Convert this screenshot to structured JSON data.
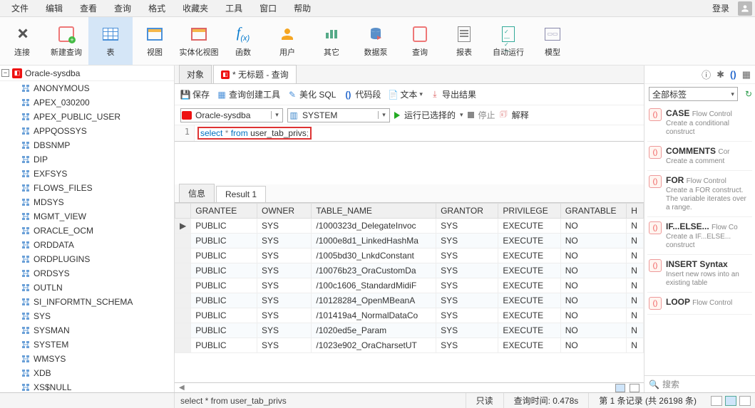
{
  "menu": {
    "items": [
      "文件",
      "编辑",
      "查看",
      "查询",
      "格式",
      "收藏夹",
      "工具",
      "窗口",
      "帮助"
    ],
    "login": "登录"
  },
  "toolbar": [
    {
      "label": "连接",
      "icon": "plug"
    },
    {
      "label": "新建查询",
      "icon": "newq"
    },
    {
      "label": "表",
      "icon": "table",
      "active": true
    },
    {
      "label": "视图",
      "icon": "view"
    },
    {
      "label": "实体化视图",
      "icon": "mview"
    },
    {
      "label": "函数",
      "icon": "fx"
    },
    {
      "label": "用户",
      "icon": "user"
    },
    {
      "label": "其它",
      "icon": "other"
    },
    {
      "label": "数据泵",
      "icon": "pump"
    },
    {
      "label": "查询",
      "icon": "query"
    },
    {
      "label": "报表",
      "icon": "report"
    },
    {
      "label": "自动运行",
      "icon": "auto"
    },
    {
      "label": "模型",
      "icon": "model"
    }
  ],
  "connection_name": "Oracle-sysdba",
  "users": [
    "ANONYMOUS",
    "APEX_030200",
    "APEX_PUBLIC_USER",
    "APPQOSSYS",
    "DBSNMP",
    "DIP",
    "EXFSYS",
    "FLOWS_FILES",
    "MDSYS",
    "MGMT_VIEW",
    "ORACLE_OCM",
    "ORDDATA",
    "ORDPLUGINS",
    "ORDSYS",
    "OUTLN",
    "SI_INFORMTN_SCHEMA",
    "SYS",
    "SYSMAN",
    "SYSTEM",
    "WMSYS",
    "XDB",
    "XS$NULL"
  ],
  "editor_tabs": {
    "t1": "对象",
    "t2": "* 无标题 - 查询"
  },
  "query_tb": {
    "save": "保存",
    "builder": "查询创建工具",
    "beautify": "美化 SQL",
    "snippet": "代码段",
    "text": "文本",
    "export": "导出结果"
  },
  "conn_combo": "Oracle-sysdba",
  "schema_combo": "SYSTEM",
  "run_row": {
    "run": "运行已选择的",
    "stop": "停止",
    "explain": "解释"
  },
  "sql_line_no": "1",
  "sql": {
    "kw1": "select",
    "star": "*",
    "kw2": "from",
    "ident": "user_tab_privs",
    "semi": ";"
  },
  "result_tabs": {
    "info": "信息",
    "res": "Result 1"
  },
  "columns": [
    "GRANTEE",
    "OWNER",
    "TABLE_NAME",
    "GRANTOR",
    "PRIVILEGE",
    "GRANTABLE",
    "H"
  ],
  "rows": [
    {
      "GRANTEE": "PUBLIC",
      "OWNER": "SYS",
      "TABLE_NAME": "/1000323d_DelegateInvoc",
      "GRANTOR": "SYS",
      "PRIVILEGE": "EXECUTE",
      "GRANTABLE": "NO",
      "H": "N"
    },
    {
      "GRANTEE": "PUBLIC",
      "OWNER": "SYS",
      "TABLE_NAME": "/1000e8d1_LinkedHashMa",
      "GRANTOR": "SYS",
      "PRIVILEGE": "EXECUTE",
      "GRANTABLE": "NO",
      "H": "N"
    },
    {
      "GRANTEE": "PUBLIC",
      "OWNER": "SYS",
      "TABLE_NAME": "/1005bd30_LnkdConstant",
      "GRANTOR": "SYS",
      "PRIVILEGE": "EXECUTE",
      "GRANTABLE": "NO",
      "H": "N"
    },
    {
      "GRANTEE": "PUBLIC",
      "OWNER": "SYS",
      "TABLE_NAME": "/10076b23_OraCustomDa",
      "GRANTOR": "SYS",
      "PRIVILEGE": "EXECUTE",
      "GRANTABLE": "NO",
      "H": "N"
    },
    {
      "GRANTEE": "PUBLIC",
      "OWNER": "SYS",
      "TABLE_NAME": "/100c1606_StandardMidiF",
      "GRANTOR": "SYS",
      "PRIVILEGE": "EXECUTE",
      "GRANTABLE": "NO",
      "H": "N"
    },
    {
      "GRANTEE": "PUBLIC",
      "OWNER": "SYS",
      "TABLE_NAME": "/10128284_OpenMBeanA",
      "GRANTOR": "SYS",
      "PRIVILEGE": "EXECUTE",
      "GRANTABLE": "NO",
      "H": "N"
    },
    {
      "GRANTEE": "PUBLIC",
      "OWNER": "SYS",
      "TABLE_NAME": "/101419a4_NormalDataCo",
      "GRANTOR": "SYS",
      "PRIVILEGE": "EXECUTE",
      "GRANTABLE": "NO",
      "H": "N"
    },
    {
      "GRANTEE": "PUBLIC",
      "OWNER": "SYS",
      "TABLE_NAME": "/1020ed5e_Param",
      "GRANTOR": "SYS",
      "PRIVILEGE": "EXECUTE",
      "GRANTABLE": "NO",
      "H": "N"
    },
    {
      "GRANTEE": "PUBLIC",
      "OWNER": "SYS",
      "TABLE_NAME": "/1023e902_OraCharsetUT",
      "GRANTOR": "SYS",
      "PRIVILEGE": "EXECUTE",
      "GRANTABLE": "NO",
      "H": "N"
    }
  ],
  "right": {
    "tag_label": "全部标签",
    "snippets": [
      {
        "title": "CASE",
        "sub": "Flow Control",
        "desc": "Create a conditional construct"
      },
      {
        "title": "COMMENTS",
        "sub": "Cor",
        "desc": "Create a comment"
      },
      {
        "title": "FOR",
        "sub": "Flow Control",
        "desc": "Create a FOR construct. The variable iterates over a range."
      },
      {
        "title": "IF...ELSE...",
        "sub": "Flow Co",
        "desc": "Create a IF...ELSE... construct"
      },
      {
        "title": "INSERT Syntax",
        "sub": "",
        "desc": "Insert new rows into an existing table"
      },
      {
        "title": "LOOP",
        "sub": "Flow Control",
        "desc": ""
      }
    ],
    "search_placeholder": "搜索"
  },
  "statusbar": {
    "sql": "select * from user_tab_privs",
    "readonly": "只读",
    "qtime": "查询时间: 0.478s",
    "records": "第 1 条记录 (共 26198 条)"
  }
}
